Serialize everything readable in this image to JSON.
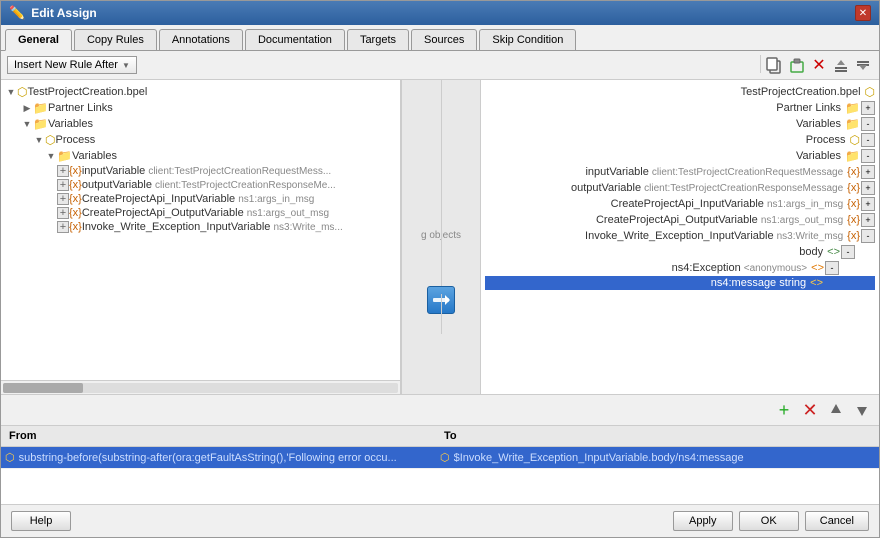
{
  "dialog": {
    "title": "Edit Assign",
    "title_icon": "✏️"
  },
  "tabs": [
    {
      "id": "general",
      "label": "General",
      "active": true
    },
    {
      "id": "copy-rules",
      "label": "Copy Rules",
      "active": false
    },
    {
      "id": "annotations",
      "label": "Annotations",
      "active": false
    },
    {
      "id": "documentation",
      "label": "Documentation",
      "active": false
    },
    {
      "id": "targets",
      "label": "Targets",
      "active": false
    },
    {
      "id": "sources",
      "label": "Sources",
      "active": false
    },
    {
      "id": "skip-condition",
      "label": "Skip Condition",
      "active": false
    }
  ],
  "toolbar": {
    "insert_btn_label": "Insert New Rule After",
    "icons": [
      "copy",
      "paste",
      "delete",
      "move-up",
      "move-down"
    ]
  },
  "left_tree": {
    "file": "TestProjectCreation.bpel",
    "items": [
      {
        "indent": 0,
        "type": "bpel",
        "label": "TestProjectCreation.bpel",
        "expanded": true
      },
      {
        "indent": 1,
        "type": "folder",
        "label": "Partner Links",
        "expanded": false
      },
      {
        "indent": 1,
        "type": "folder",
        "label": "Variables",
        "expanded": true
      },
      {
        "indent": 2,
        "type": "folder",
        "label": "Process",
        "expanded": true
      },
      {
        "indent": 3,
        "type": "folder",
        "label": "Variables",
        "expanded": true
      },
      {
        "indent": 4,
        "type": "var",
        "label": "inputVariable",
        "detail": "client:TestProjectCreationRequestMess...",
        "has_expand": true
      },
      {
        "indent": 4,
        "type": "var",
        "label": "outputVariable",
        "detail": "client:TestProjectCreationResponseMe...",
        "has_expand": true
      },
      {
        "indent": 4,
        "type": "var",
        "label": "CreateProjectApi_InputVariable",
        "detail": "ns1:args_in_msg",
        "has_expand": true
      },
      {
        "indent": 4,
        "type": "var",
        "label": "CreateProjectApi_OutputVariable",
        "detail": "ns1:args_out_msg",
        "has_expand": true
      },
      {
        "indent": 4,
        "type": "var",
        "label": "Invoke_Write_Exception_InputVariable",
        "detail": "ns3:Write_ms...",
        "has_expand": true
      }
    ]
  },
  "right_tree": {
    "file": "TestProjectCreation.bpel",
    "items": [
      {
        "label": "TestProjectCreation.bpel",
        "type": "bpel"
      },
      {
        "label": "Partner Links",
        "type": "folder"
      },
      {
        "label": "Variables",
        "type": "folder"
      },
      {
        "label": "Process",
        "type": "folder"
      },
      {
        "label": "Variables",
        "type": "folder"
      },
      {
        "label": "inputVariable",
        "detail": "client:TestProjectCreationRequestMessage",
        "type": "var"
      },
      {
        "label": "outputVariable",
        "detail": "client:TestProjectCreationResponseMessage",
        "type": "var"
      },
      {
        "label": "CreateProjectApi_InputVariable",
        "detail": "ns1:args_in_msg",
        "type": "var"
      },
      {
        "label": "CreateProjectApi_OutputVariable",
        "detail": "ns1:args_out_msg",
        "type": "var"
      },
      {
        "label": "Invoke_Write_Exception_InputVariable",
        "detail": "ns3:Write_msg",
        "type": "var"
      },
      {
        "label": "body",
        "type": "element",
        "selected": false
      },
      {
        "label": "ns4:Exception",
        "detail": "<anonymous>",
        "type": "element"
      },
      {
        "label": "ns4:message string",
        "type": "element",
        "selected": true
      }
    ]
  },
  "mapping": {
    "from_header": "From",
    "to_header": "To",
    "rows": [
      {
        "from": "substring-before(substring-after(ora:getFaultAsString(),'Following error occu...",
        "to": "$Invoke_Write_Exception_InputVariable.body/ns4:message",
        "selected": true
      }
    ]
  },
  "footer": {
    "help_label": "Help",
    "apply_label": "Apply",
    "ok_label": "OK",
    "cancel_label": "Cancel"
  }
}
